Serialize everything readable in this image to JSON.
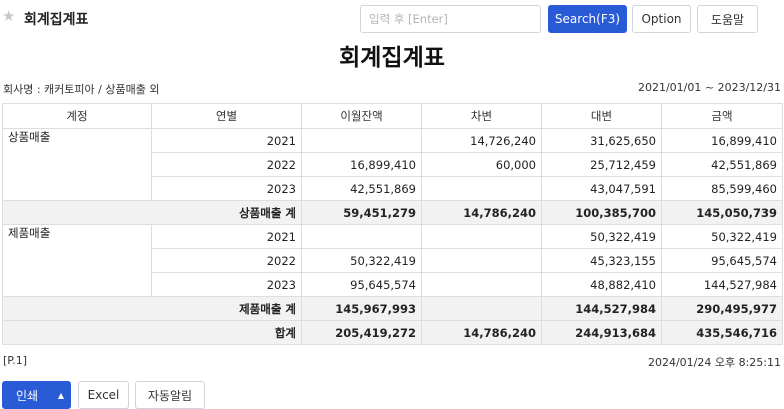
{
  "header": {
    "title": "회계집계표",
    "search_placeholder": "입력 후 [Enter]",
    "search_button": "Search(F3)",
    "option_button": "Option",
    "help_button": "도움말"
  },
  "report": {
    "title": "회계집계표",
    "company_info": "회사명 : 캐커토피아 / 상품매출 외",
    "period": "2021/01/01 ~ 2023/12/31",
    "columns": [
      "계정",
      "연별",
      "이월잔액",
      "차변",
      "대변",
      "금액"
    ],
    "groups": [
      {
        "account": "상품매출",
        "rows": [
          {
            "year": "2021",
            "carryover": "",
            "debit": "14,726,240",
            "credit": "31,625,650",
            "amount": "16,899,410"
          },
          {
            "year": "2022",
            "carryover": "16,899,410",
            "debit": "60,000",
            "credit": "25,712,459",
            "amount": "42,551,869"
          },
          {
            "year": "2023",
            "carryover": "42,551,869",
            "debit": "",
            "credit": "43,047,591",
            "amount": "85,599,460"
          }
        ],
        "subtotal": {
          "label": "상품매출 계",
          "carryover": "59,451,279",
          "debit": "14,786,240",
          "credit": "100,385,700",
          "amount": "145,050,739"
        }
      },
      {
        "account": "제품매출",
        "rows": [
          {
            "year": "2021",
            "carryover": "",
            "debit": "",
            "credit": "50,322,419",
            "amount": "50,322,419"
          },
          {
            "year": "2022",
            "carryover": "50,322,419",
            "debit": "",
            "credit": "45,323,155",
            "amount": "95,645,574"
          },
          {
            "year": "2023",
            "carryover": "95,645,574",
            "debit": "",
            "credit": "48,882,410",
            "amount": "144,527,984"
          }
        ],
        "subtotal": {
          "label": "제품매출 계",
          "carryover": "145,967,993",
          "debit": "",
          "credit": "144,527,984",
          "amount": "290,495,977"
        }
      }
    ],
    "total": {
      "label": "합계",
      "carryover": "205,419,272",
      "debit": "14,786,240",
      "credit": "244,913,684",
      "amount": "435,546,716"
    },
    "page": "[P.1]",
    "printed_at": "2024/01/24 오후 8:25:11"
  },
  "footer": {
    "print_button": "인쇄",
    "excel_button": "Excel",
    "auto_notify_button": "자동알림"
  },
  "colors": {
    "primary": "#2a5bd7",
    "subtotal_bg": "#f2f2f2",
    "border": "#dedede"
  }
}
